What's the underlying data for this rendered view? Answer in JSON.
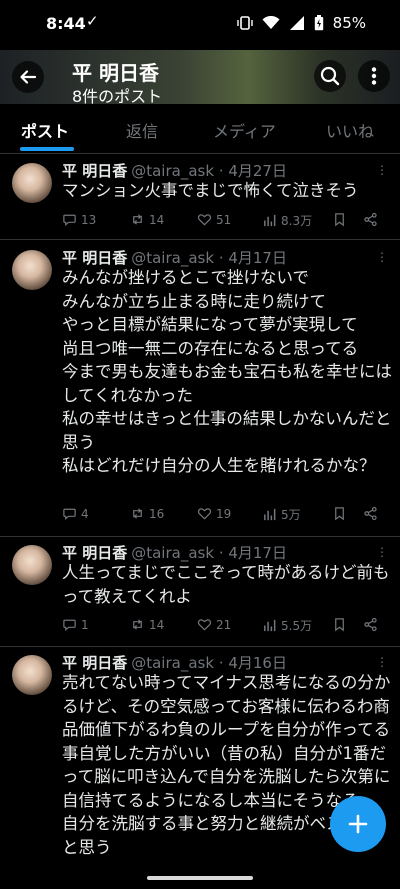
{
  "status": {
    "time": "8:44",
    "check": "✓",
    "battery": "85%"
  },
  "header": {
    "name": "平 明日香",
    "post_count": "8件のポスト"
  },
  "tabs": [
    "ポスト",
    "返信",
    "メディア",
    "いいね"
  ],
  "tweets": [
    {
      "name": "平 明日香",
      "handle": "@taira_ask",
      "date": "· 4月27日",
      "text": "マンション火事でまじで怖くて泣きそう",
      "replies": "13",
      "reposts": "14",
      "likes": "51",
      "views": "8.3万"
    },
    {
      "name": "平 明日香",
      "handle": "@taira_ask",
      "date": "· 4月17日",
      "text": "みんなが挫けるとこで挫けないで\nみんなが立ち止まる時に走り続けて\nやっと目標が結果になって夢が実現して\n尚且つ唯一無二の存在になると思ってる\n今まで男も友達もお金も宝石も私を幸せにはしてくれなかった\n私の幸せはきっと仕事の結果しかないんだと思う\n私はどれだけ自分の人生を賭けれるかな？",
      "replies": "4",
      "reposts": "16",
      "likes": "19",
      "views": "5万"
    },
    {
      "name": "平 明日香",
      "handle": "@taira_ask",
      "date": "· 4月17日",
      "text": "人生ってまじでここぞって時があるけど前もって教えてくれよ",
      "replies": "1",
      "reposts": "14",
      "likes": "21",
      "views": "5.5万"
    },
    {
      "name": "平 明日香",
      "handle": "@taira_ask",
      "date": "· 4月16日",
      "text": "売れてない時ってマイナス思考になるの分かるけど、その空気感ってお客様に伝わるわ商品価値下がるわ負のループを自分が作ってる事自覚した方がいい（昔の私）自分が1番だって脳に叩き込んで自分を洗脳したら次第に自信持てるようになるし本当にそうなる\n自分を洗脳する事と努力と継続がベストだと思う"
    }
  ],
  "icons": {
    "back": "arrow-left-icon",
    "search": "search-icon",
    "more": "more-vertical-icon",
    "reply": "reply-icon",
    "repost": "repost-icon",
    "like": "heart-icon",
    "views": "views-icon",
    "bookmark": "bookmark-icon",
    "share": "share-icon",
    "compose": "plus-icon"
  },
  "colors": {
    "accent": "#1d9bf0",
    "background": "#000000",
    "text": "#e7e9ea",
    "muted": "#71767b"
  }
}
